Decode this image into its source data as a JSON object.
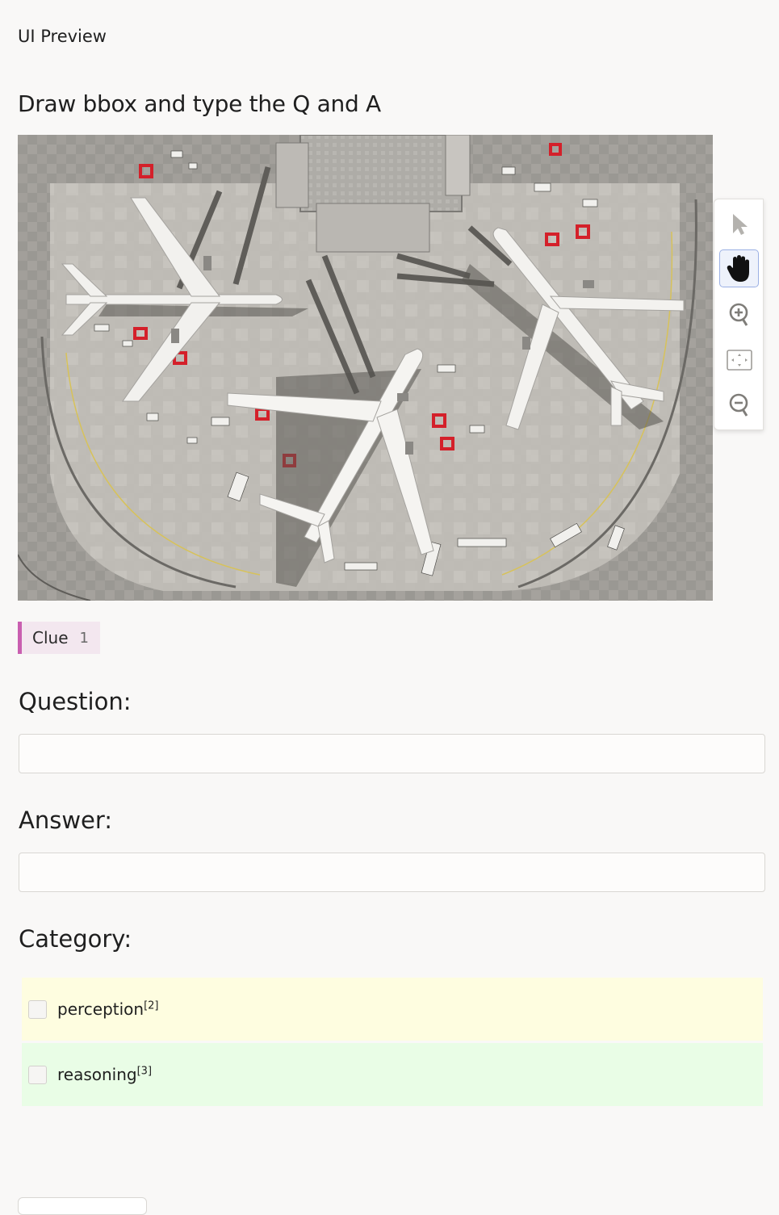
{
  "header": {
    "title": "UI Preview"
  },
  "task": {
    "title": "Draw bbox and type the Q and A"
  },
  "toolbar": {
    "tools": [
      {
        "name": "pointer-icon",
        "active": false
      },
      {
        "name": "hand-icon",
        "active": true
      },
      {
        "name": "zoom-in-icon",
        "active": false
      },
      {
        "name": "fit-screen-icon",
        "active": false
      },
      {
        "name": "zoom-out-icon",
        "active": false
      }
    ]
  },
  "label_tag": {
    "label": "Clue",
    "hotkey": "1",
    "color": "#c95fb0"
  },
  "question": {
    "label": "Question:",
    "value": "",
    "placeholder": ""
  },
  "answer": {
    "label": "Answer:",
    "value": "",
    "placeholder": ""
  },
  "category": {
    "label": "Category:",
    "choices": [
      {
        "label": "perception",
        "hotkey": "[2]",
        "color": "#fefde0",
        "checked": false
      },
      {
        "label": "reasoning",
        "hotkey": "[3]",
        "color": "#e9fde6",
        "checked": false
      }
    ]
  }
}
